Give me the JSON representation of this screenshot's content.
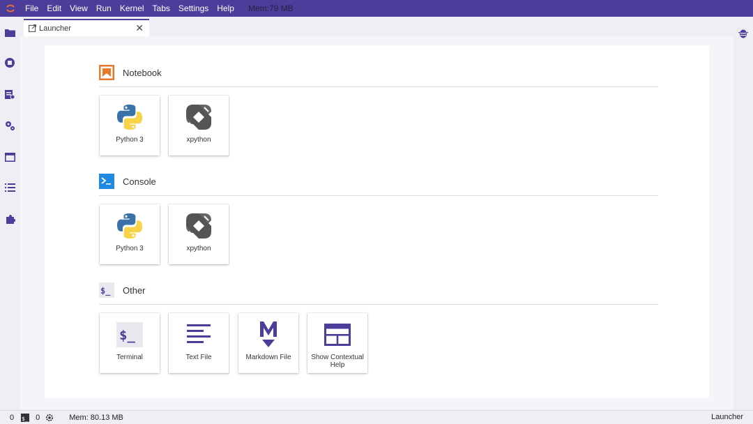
{
  "menubar": {
    "items": [
      "File",
      "Edit",
      "View",
      "Run",
      "Kernel",
      "Tabs",
      "Settings",
      "Help"
    ],
    "mem": "Mem:79 MB"
  },
  "left_sidebar": {
    "icons": [
      "folder-icon",
      "running-icon",
      "commands-icon",
      "settings-icon",
      "tabs-icon",
      "toc-icon",
      "extension-icon"
    ]
  },
  "right_sidebar": {
    "icons": [
      "debugger-icon"
    ]
  },
  "tab": {
    "label": "Launcher"
  },
  "launcher": {
    "sections": [
      {
        "title": "Notebook",
        "icon": "notebook-icon",
        "cards": [
          {
            "label": "Python 3",
            "icon": "python-logo-icon"
          },
          {
            "label": "xpython",
            "icon": "xpython-logo-icon"
          }
        ]
      },
      {
        "title": "Console",
        "icon": "console-icon",
        "cards": [
          {
            "label": "Python 3",
            "icon": "python-logo-icon"
          },
          {
            "label": "xpython",
            "icon": "xpython-logo-icon"
          }
        ]
      },
      {
        "title": "Other",
        "icon": "terminal-section-icon",
        "cards": [
          {
            "label": "Terminal",
            "icon": "terminal-icon"
          },
          {
            "label": "Text File",
            "icon": "text-file-icon"
          },
          {
            "label": "Markdown File",
            "icon": "markdown-icon"
          },
          {
            "label": "Show Contextual Help",
            "icon": "contextual-help-icon"
          }
        ]
      }
    ]
  },
  "statusbar": {
    "kernels": "0",
    "terminals": "0",
    "mem": "Mem: 80.13 MB",
    "right_label": "Launcher"
  },
  "colors": {
    "brand": "#4c3d9a",
    "notebook_orange": "#e57a2a",
    "console_blue": "#1f8ae0",
    "icon_purple": "#4c3d9a",
    "python_blue": "#3a71a6",
    "python_yellow": "#f7d34a",
    "xpython_gray": "#555555"
  }
}
